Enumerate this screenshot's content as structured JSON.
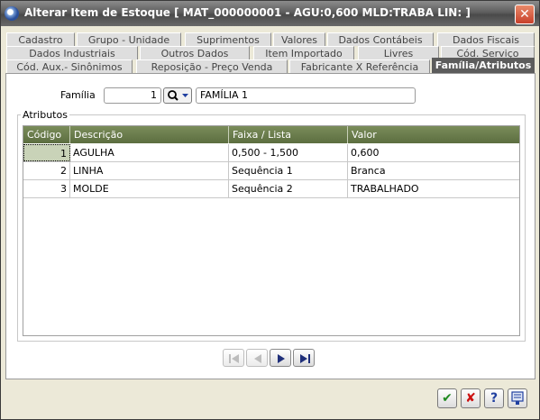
{
  "window": {
    "title": "Alterar Item de Estoque [ MAT_000000001 - AGU:0,600 MLD:TRABA LIN: ]",
    "close_glyph": "✕"
  },
  "tabs": {
    "row1": [
      "Cadastro",
      "Grupo - Unidade",
      "Suprimentos",
      "Valores",
      "Dados Contábeis",
      "Dados Fiscais"
    ],
    "row2": [
      "Dados Industriais",
      "Outros Dados",
      "Item Importado",
      "Livres",
      "Cód. Serviço"
    ],
    "row3": [
      "Cód. Aux.- Sinônimos",
      "Reposição - Preço Venda",
      "Fabricante X Referência",
      "Família/Atributos"
    ],
    "active": "Família/Atributos"
  },
  "familia": {
    "label": "Família",
    "code": "1",
    "name": "FAMÍLIA 1"
  },
  "atributos": {
    "group_title": "Atributos",
    "columns": [
      "Código",
      "Descrição",
      "Faixa / Lista",
      "Valor"
    ],
    "rows": [
      {
        "codigo": "1",
        "descricao": "AGULHA",
        "faixa": "0,500 - 1,500",
        "valor": "0,600"
      },
      {
        "codigo": "2",
        "descricao": "LINHA",
        "faixa": "Sequência 1",
        "valor": "Branca"
      },
      {
        "codigo": "3",
        "descricao": "MOLDE",
        "faixa": "Sequência 2",
        "valor": "TRABALHADO"
      }
    ]
  },
  "icons": {
    "lookup": "search-icon",
    "first": "first-page-icon",
    "prev": "previous-icon",
    "next": "next-icon",
    "last": "last-page-icon",
    "confirm": "check-icon",
    "cancel": "cancel-icon",
    "help": "help-icon",
    "extra": "export-icon"
  },
  "actions": {
    "confirm_glyph": "✔",
    "cancel_glyph": "✘",
    "help_glyph": "?"
  },
  "colors": {
    "grid_header": "#6b7d4d",
    "active_tab": "#5c5c5c",
    "confirm": "#1f8a1f",
    "cancel": "#cc1111",
    "help": "#1f3fa0"
  }
}
